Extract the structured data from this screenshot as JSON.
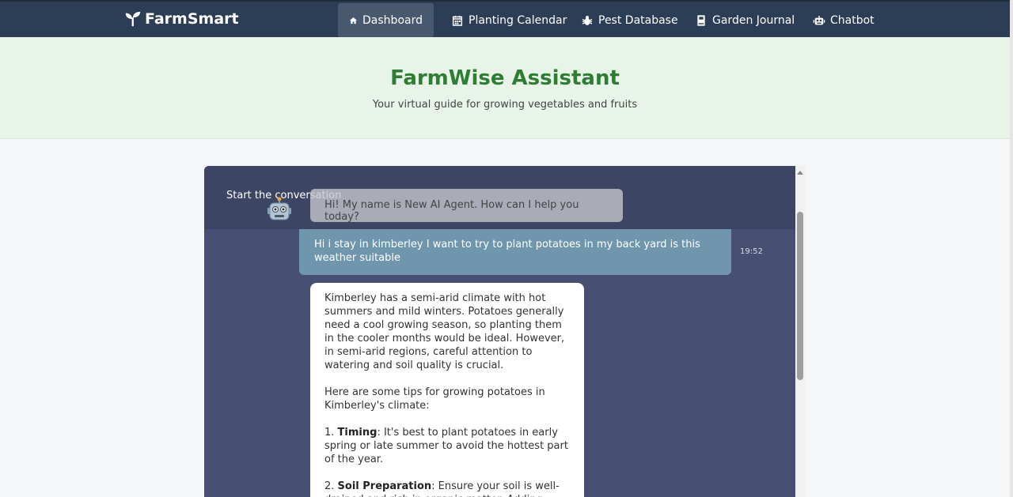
{
  "navbar": {
    "brand": "FarmSmart",
    "items": [
      {
        "label": "Dashboard",
        "icon": "home-icon",
        "active": true
      },
      {
        "label": "Planting Calendar",
        "icon": "calendar-icon",
        "active": false
      },
      {
        "label": "Pest Database",
        "icon": "bug-icon",
        "active": false
      },
      {
        "label": "Garden Journal",
        "icon": "journal-icon",
        "active": false
      },
      {
        "label": "Chatbot",
        "icon": "robot-icon",
        "active": false
      }
    ]
  },
  "hero": {
    "title": "FarmWise Assistant",
    "subtitle": "Your virtual guide for growing vegetables and fruits"
  },
  "chat": {
    "start_label": "Start the conversation",
    "greeting": "Hi! My name is New AI Agent. How can I help you today?",
    "user_message": "Hi i stay in kimberley I want to try to plant potatoes in my back yard is this weather suitable",
    "user_time": "19:52",
    "bot_reply": {
      "para1": "Kimberley has a semi-arid climate with hot summers and mild winters. Potatoes generally need a cool growing season, so planting them in the cooler months would be ideal. However, in semi-arid regions, careful attention to watering and soil quality is crucial.",
      "para2": "Here are some tips for growing potatoes in Kimberley's climate:",
      "tip1_num": "1.",
      "tip1_title": "Timing",
      "tip1_text": ": It's best to plant potatoes in early spring or late summer to avoid the hottest part of the year.",
      "tip2_num": "2.",
      "tip2_title": "Soil Preparation",
      "tip2_text": ": Ensure your soil is well-drained and rich in organic matter. Adding"
    }
  },
  "colors": {
    "navbar_bg": "#2c3e55",
    "hero_bg": "#e8f4e8",
    "hero_title": "#2e7d32",
    "chat_bg": "#474f72",
    "user_bubble": "#6f96ad"
  }
}
